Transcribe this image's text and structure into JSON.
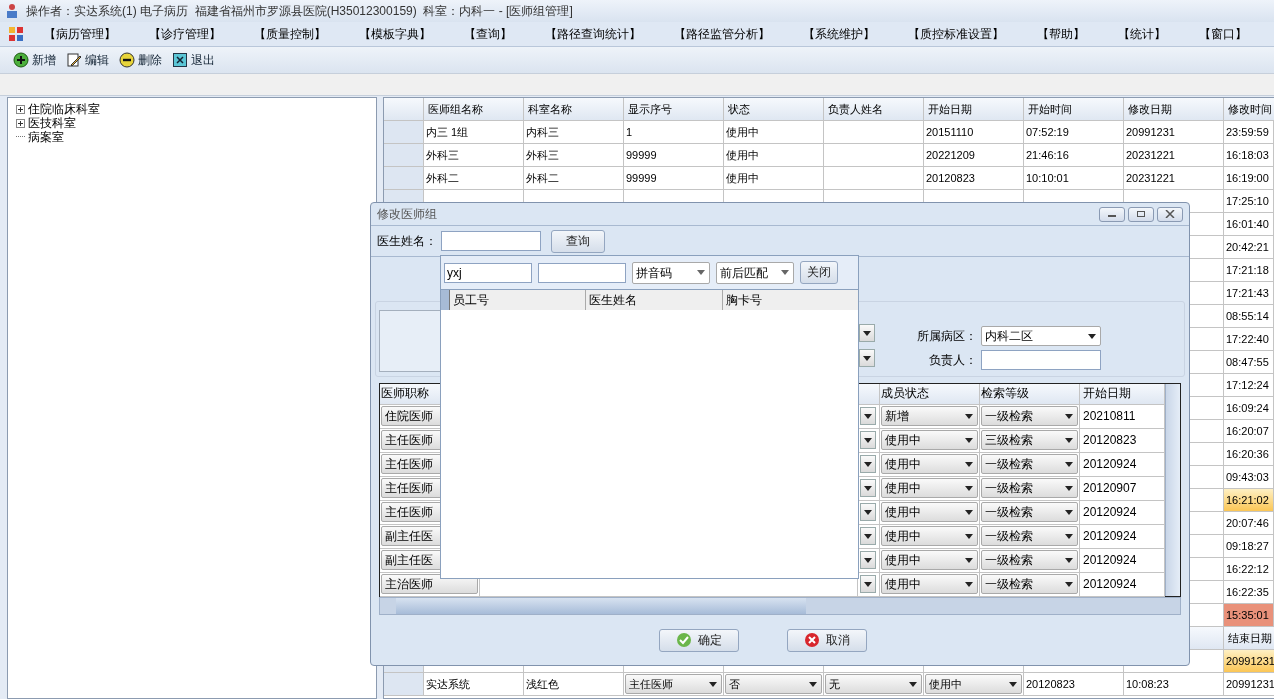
{
  "title_bar": {
    "title": "操作者：实达系统(1) 电子病历  福建省福州市罗源县医院(H35012300159)  科室：内科一 - [医师组管理]"
  },
  "menu": [
    "【病历管理】",
    "【诊疗管理】",
    "【质量控制】",
    "【模板字典】",
    "【查询】",
    "【路径查询统计】",
    "【路径监管分析】",
    "【系统维护】",
    "【质控标准设置】",
    "【帮助】",
    "【统计】",
    "【窗口】"
  ],
  "toolbar": [
    {
      "kind": "add",
      "label": "新增"
    },
    {
      "kind": "edit",
      "label": "编辑"
    },
    {
      "kind": "delete",
      "label": "删除"
    },
    {
      "kind": "exit",
      "label": "退出"
    }
  ],
  "tree": [
    {
      "label": "住院临床科室",
      "expanded": false
    },
    {
      "label": "医技科室",
      "expanded": false
    },
    {
      "label": "病案室"
    }
  ],
  "group_grid": {
    "columns": [
      "医师组名称",
      "科室名称",
      "显示序号",
      "状态",
      "负责人姓名",
      "开始日期",
      "开始时间",
      "修改日期",
      "修改时间"
    ],
    "rows": [
      {
        "cells": [
          "内三 1组",
          "内科三",
          "1",
          "使用中",
          "",
          "20151110",
          "07:52:19",
          "20991231",
          "23:59:59"
        ]
      },
      {
        "cells": [
          "外科三",
          "外科三",
          "99999",
          "使用中",
          "",
          "20221209",
          "21:46:16",
          "20231221",
          "16:18:03"
        ]
      },
      {
        "cells": [
          "外科二",
          "外科二",
          "99999",
          "使用中",
          "",
          "20120823",
          "10:10:01",
          "20231221",
          "16:19:00"
        ]
      }
    ],
    "covered_rows": [
      {
        "time": "17:25:10",
        "selected": false,
        "flagged": false
      },
      {
        "time": "16:01:40",
        "selected": false,
        "flagged": false
      },
      {
        "time": "20:42:21",
        "selected": false,
        "flagged": false
      },
      {
        "time": "17:21:18",
        "selected": false,
        "flagged": false
      },
      {
        "time": "17:21:43",
        "selected": false,
        "flagged": false
      },
      {
        "time": "08:55:14",
        "selected": false,
        "flagged": false
      },
      {
        "time": "17:22:40",
        "selected": false,
        "flagged": false
      },
      {
        "time": "08:47:55",
        "selected": false,
        "flagged": false
      },
      {
        "time": "17:12:24",
        "selected": false,
        "flagged": false
      },
      {
        "time": "16:09:24",
        "selected": false,
        "flagged": false
      },
      {
        "time": "16:20:07",
        "selected": false,
        "flagged": false
      },
      {
        "time": "16:20:36",
        "selected": false,
        "flagged": false
      },
      {
        "time": "09:43:03",
        "selected": false,
        "flagged": false
      },
      {
        "time": "16:21:02",
        "selected": true,
        "flagged": false
      },
      {
        "time": "20:07:46",
        "selected": false,
        "flagged": false
      },
      {
        "time": "09:18:27",
        "selected": false,
        "flagged": false
      },
      {
        "time": "16:22:12",
        "selected": false,
        "flagged": false
      },
      {
        "time": "16:22:35",
        "selected": false,
        "flagged": false
      },
      {
        "time": "15:35:01",
        "selected": false,
        "flagged": true
      }
    ]
  },
  "member_grid": {
    "end_date_column": "结束日期",
    "covered_rows": [
      {
        "end_date": "20991231",
        "selected": true
      }
    ],
    "rows": [
      {
        "cells": [
          {
            "kind": "text",
            "text": "实达系统"
          },
          {
            "kind": "text",
            "text": "浅红色"
          },
          {
            "kind": "combo",
            "text": "主任医师"
          },
          {
            "kind": "combo",
            "text": "否"
          },
          {
            "kind": "combo",
            "text": "无"
          },
          {
            "kind": "combo",
            "text": "使用中"
          },
          {
            "kind": "text",
            "text": "20120823"
          },
          {
            "kind": "text",
            "text": "10:08:23"
          },
          {
            "kind": "text",
            "text": "20991231"
          }
        ]
      }
    ]
  },
  "dialog": {
    "title": "修改医师组",
    "search_label": "医生姓名：",
    "search_button": "查询",
    "ward_label": "所属病区：",
    "ward_value": "内科二区",
    "owner_label": "负责人：",
    "grid": {
      "columns": [
        "医师职称",
        "成员状态",
        "检索等级",
        "开始日期"
      ],
      "rows": [
        {
          "title": "住院医师",
          "member_status": "新增",
          "search_level": "一级检索",
          "start_date": "20210811"
        },
        {
          "title": "主任医师",
          "member_status": "使用中",
          "search_level": "三级检索",
          "start_date": "20120823"
        },
        {
          "title": "主任医师",
          "member_status": "使用中",
          "search_level": "一级检索",
          "start_date": "20120924"
        },
        {
          "title": "主任医师",
          "member_status": "使用中",
          "search_level": "一级检索",
          "start_date": "20120907"
        },
        {
          "title": "主任医师",
          "member_status": "使用中",
          "search_level": "一级检索",
          "start_date": "20120924"
        },
        {
          "title": "副主任医",
          "member_status": "使用中",
          "search_level": "一级检索",
          "start_date": "20120924"
        },
        {
          "title": "副主任医",
          "member_status": "使用中",
          "search_level": "一级检索",
          "start_date": "20120924"
        },
        {
          "title": "主治医师",
          "member_status": "使用中",
          "search_level": "一级检索",
          "start_date": "20120924"
        }
      ]
    },
    "ok_button": "确定",
    "cancel_button": "取消"
  },
  "lookup": {
    "keyword": "yxj",
    "code_type": "拼音码",
    "match_mode": "前后匹配",
    "close_button": "关闭",
    "columns": [
      "员工号",
      "医生姓名",
      "胸卡号"
    ]
  }
}
